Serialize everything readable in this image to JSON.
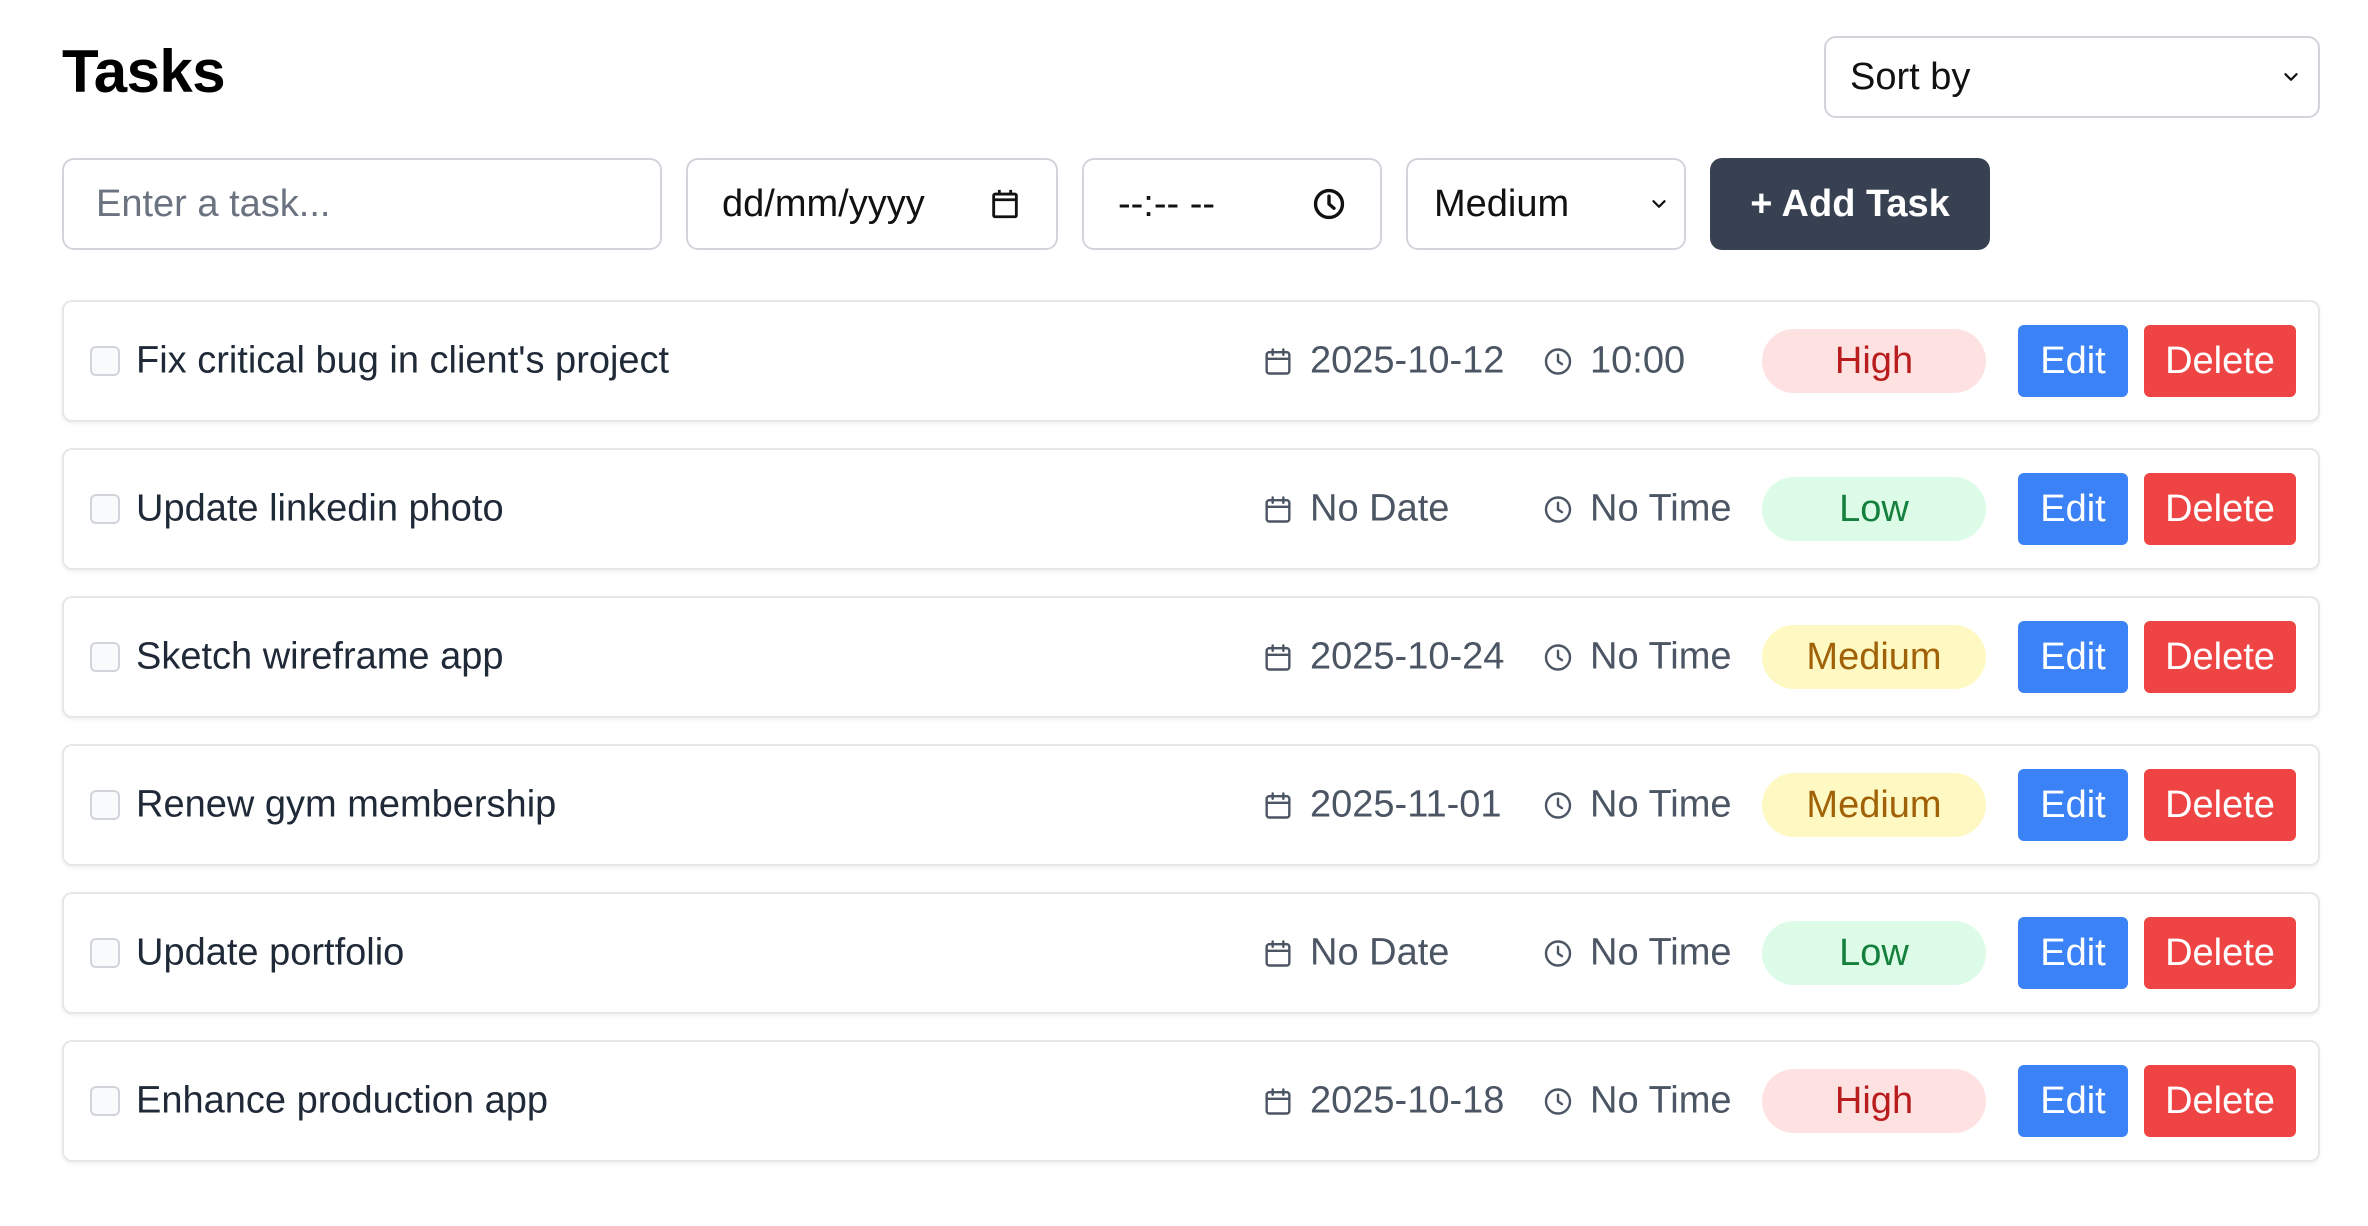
{
  "header": {
    "title": "Tasks",
    "sort_label": "Sort by"
  },
  "form": {
    "task_placeholder": "Enter a task...",
    "date_placeholder": "dd/mm/yyyy",
    "time_placeholder": "--:-- --",
    "priority_value": "Medium",
    "add_label": "+ Add Task"
  },
  "tasks": [
    {
      "title": "Fix critical bug in client's project",
      "date": "2025-10-12",
      "time": "10:00",
      "priority": "High",
      "edit_label": "Edit",
      "delete_label": "Delete"
    },
    {
      "title": "Update linkedin photo",
      "date": "No Date",
      "time": "No Time",
      "priority": "Low",
      "edit_label": "Edit",
      "delete_label": "Delete"
    },
    {
      "title": "Sketch wireframe app",
      "date": "2025-10-24",
      "time": "No Time",
      "priority": "Medium",
      "edit_label": "Edit",
      "delete_label": "Delete"
    },
    {
      "title": "Renew gym membership",
      "date": "2025-11-01",
      "time": "No Time",
      "priority": "Medium",
      "edit_label": "Edit",
      "delete_label": "Delete"
    },
    {
      "title": "Update portfolio",
      "date": "No Date",
      "time": "No Time",
      "priority": "Low",
      "edit_label": "Edit",
      "delete_label": "Delete"
    },
    {
      "title": "Enhance production app",
      "date": "2025-10-18",
      "time": "No Time",
      "priority": "High",
      "edit_label": "Edit",
      "delete_label": "Delete"
    }
  ],
  "icons": {
    "date": "calendar-icon",
    "time": "clock-icon",
    "select": "chevron-down-icon"
  },
  "colors": {
    "add_button": "#374151",
    "edit_button": "#3b82f6",
    "delete_button": "#ef4444",
    "high_bg": "#fee2e2",
    "high_text": "#b91c1c",
    "low_bg": "#dcfce7",
    "low_text": "#15803d",
    "medium_bg": "#fef9c3",
    "medium_text": "#a16207"
  }
}
